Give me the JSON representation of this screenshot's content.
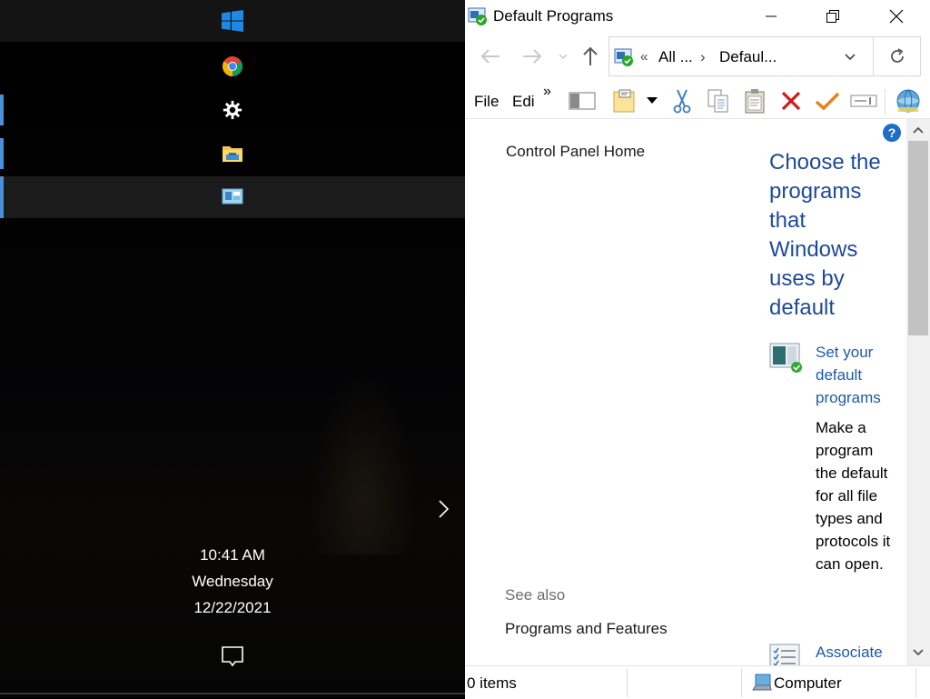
{
  "clock": {
    "time": "10:41 AM",
    "day": "Wednesday",
    "date": "12/22/2021"
  },
  "taskbar_icons": [
    "windows-start-icon",
    "chrome-icon",
    "settings-gear-icon",
    "file-explorer-icon",
    "control-panel-icon"
  ],
  "window": {
    "title": "Default Programs",
    "breadcrumb": {
      "overflow": "«",
      "item1": "All ...",
      "separator": "›",
      "item2": "Defaul..."
    },
    "menu": {
      "file": "File",
      "edit": "Edi",
      "overflow": "»"
    },
    "help": "?"
  },
  "sidebar": {
    "home": "Control Panel Home",
    "see_also": "See also",
    "programs_features": "Programs and Features"
  },
  "main": {
    "heading": "Choose the programs that Windows uses by default",
    "set_default_link": "Set your default programs",
    "set_default_desc": "Make a program the default for all file types and protocols it can open.",
    "associate_link": "Associate"
  },
  "status": {
    "items": "0 items",
    "computer": "Computer"
  },
  "colors": {
    "accent": "#4a90d9",
    "link": "#1f5aa6",
    "heading": "#1e4a99"
  }
}
